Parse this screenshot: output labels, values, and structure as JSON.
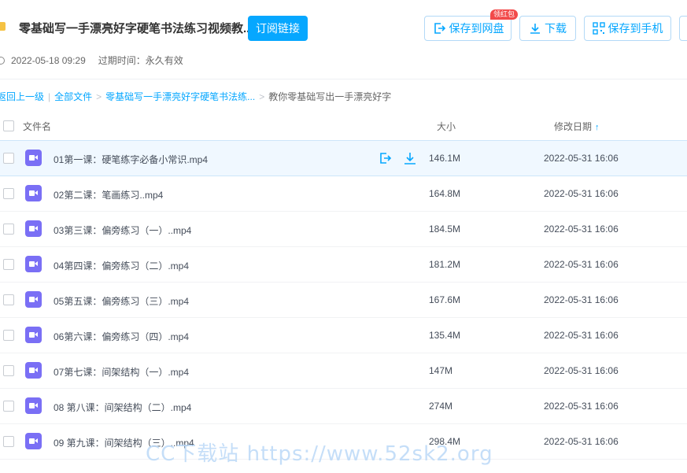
{
  "header": {
    "title": "零基础写一手漂亮好字硬笔书法练习视频教...",
    "subscribe_label": "订阅链接",
    "created_at": "2022-05-18 09:29",
    "expire_text": "过期时间：永久有效"
  },
  "actions": {
    "save_disk_label": "保存到网盘",
    "badge_label": "领红包",
    "download_label": "下载",
    "save_phone_label": "保存到手机"
  },
  "breadcrumb": {
    "back_label": "返回上一级",
    "sep1": "|",
    "all_files_label": "全部文件",
    "sep2": ">",
    "folder_label": "零基础写一手漂亮好字硬笔书法练...",
    "sep3": ">",
    "current_label": "教你零基础写出一手漂亮好字"
  },
  "columns": {
    "name": "文件名",
    "size": "大小",
    "date": "修改日期",
    "sort_glyph": "↑"
  },
  "files": [
    {
      "name": "01第一课：硬笔练字必备小常识.mp4",
      "size": "146.1M",
      "date": "2022-05-31 16:06"
    },
    {
      "name": "02第二课：笔画练习..mp4",
      "size": "164.8M",
      "date": "2022-05-31 16:06"
    },
    {
      "name": "03第三课：偏旁练习（一）..mp4",
      "size": "184.5M",
      "date": "2022-05-31 16:06"
    },
    {
      "name": "04第四课：偏旁练习（二）.mp4",
      "size": "181.2M",
      "date": "2022-05-31 16:06"
    },
    {
      "name": "05第五课：偏旁练习（三）.mp4",
      "size": "167.6M",
      "date": "2022-05-31 16:06"
    },
    {
      "name": "06第六课：偏旁练习（四）.mp4",
      "size": "135.4M",
      "date": "2022-05-31 16:06"
    },
    {
      "name": "07第七课：间架结构（一）.mp4",
      "size": "147M",
      "date": "2022-05-31 16:06"
    },
    {
      "name": "08 第八课：间架结构（二）.mp4",
      "size": "274M",
      "date": "2022-05-31 16:06"
    },
    {
      "name": "09 第九课：间架结构（三）..mp4",
      "size": "298.4M",
      "date": "2022-05-31 16:06"
    }
  ],
  "watermark": "CC下载站 https://www.52sk2.org",
  "colors": {
    "accent": "#06a7ff",
    "video_icon": "#7a6ff5",
    "badge": "#f24a4a",
    "folder": "#f5c243"
  }
}
